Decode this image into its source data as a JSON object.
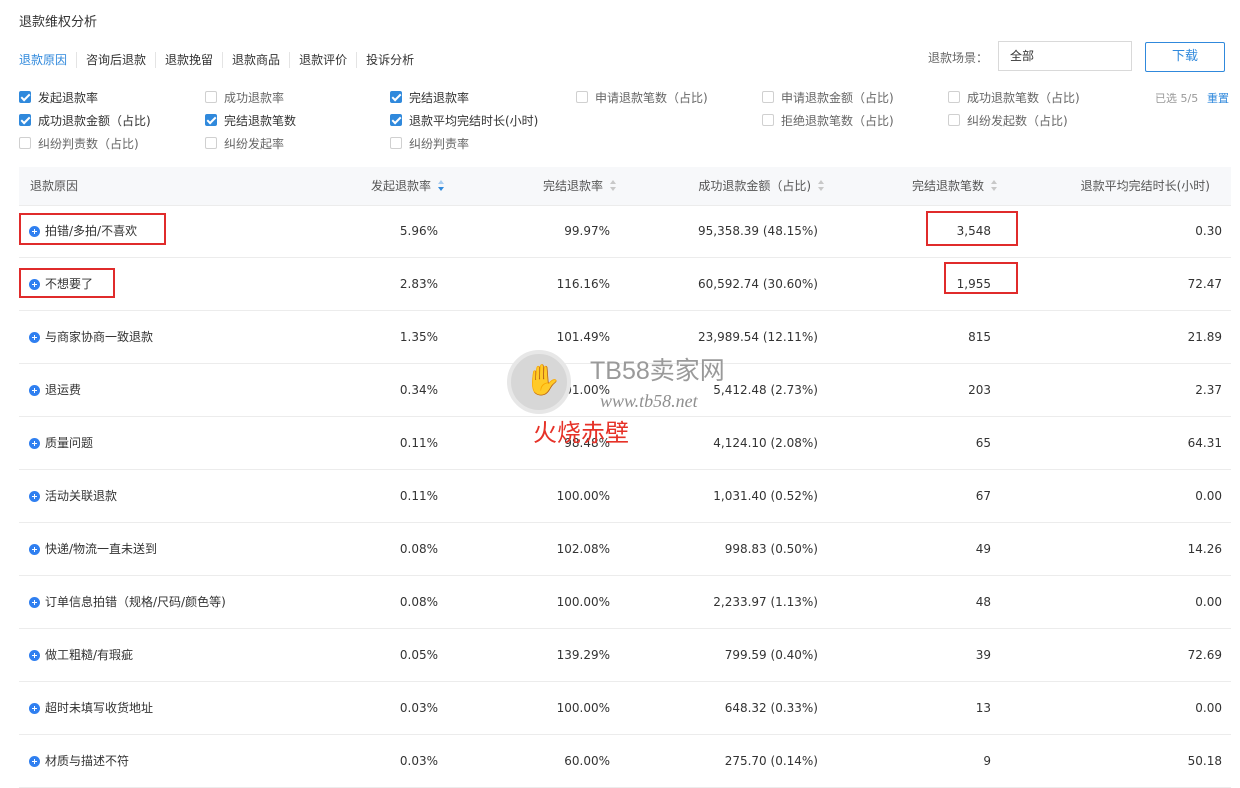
{
  "page": {
    "title": "退款维权分析"
  },
  "tabs": [
    {
      "label": "退款原因",
      "active": true
    },
    {
      "label": "咨询后退款",
      "active": false
    },
    {
      "label": "退款挽留",
      "active": false
    },
    {
      "label": "退款商品",
      "active": false
    },
    {
      "label": "退款评价",
      "active": false
    },
    {
      "label": "投诉分析",
      "active": false
    }
  ],
  "filter": {
    "scene_label": "退款场景：",
    "scene_value": "全部",
    "download_label": "下载"
  },
  "metrics": [
    {
      "label": "发起退款率",
      "checked": true
    },
    {
      "label": "成功退款率",
      "checked": false
    },
    {
      "label": "完结退款率",
      "checked": true
    },
    {
      "label": "申请退款笔数（占比)",
      "checked": false
    },
    {
      "label": "申请退款金额（占比)",
      "checked": false
    },
    {
      "label": "成功退款笔数（占比)",
      "checked": false
    },
    {
      "label": "成功退款金额（占比)",
      "checked": true
    },
    {
      "label": "完结退款笔数",
      "checked": true
    },
    {
      "label": "退款平均完结时长(小时)",
      "checked": true
    },
    {
      "label": "拒绝退款笔数（占比)",
      "checked": false
    },
    {
      "label": "纠纷发起数（占比)",
      "checked": false
    },
    {
      "label": "纠纷判责数（占比)",
      "checked": false
    },
    {
      "label": "纠纷发起率",
      "checked": false
    },
    {
      "label": "纠纷判责率",
      "checked": false
    }
  ],
  "selection": {
    "count": "已选 5/5",
    "reset": "重置"
  },
  "table": {
    "headers": [
      "退款原因",
      "发起退款率",
      "完结退款率",
      "成功退款金额（占比)",
      "完结退款笔数",
      "退款平均完结时长(小时)"
    ],
    "rows": [
      [
        "拍错/多拍/不喜欢",
        "5.96%",
        "99.97%",
        "95,358.39 (48.15%)",
        "3,548",
        "0.30"
      ],
      [
        "不想要了",
        "2.83%",
        "116.16%",
        "60,592.74 (30.60%)",
        "1,955",
        "72.47"
      ],
      [
        "与商家协商一致退款",
        "1.35%",
        "101.49%",
        "23,989.54 (12.11%)",
        "815",
        "21.89"
      ],
      [
        "退运费",
        "0.34%",
        "101.00%",
        "5,412.48 (2.73%)",
        "203",
        "2.37"
      ],
      [
        "质量问题",
        "0.11%",
        "98.48%",
        "4,124.10 (2.08%)",
        "65",
        "64.31"
      ],
      [
        "活动关联退款",
        "0.11%",
        "100.00%",
        "1,031.40 (0.52%)",
        "67",
        "0.00"
      ],
      [
        "快递/物流一直未送到",
        "0.08%",
        "102.08%",
        "998.83 (0.50%)",
        "49",
        "14.26"
      ],
      [
        "订单信息拍错（规格/尺码/颜色等)",
        "0.08%",
        "100.00%",
        "2,233.97 (1.13%)",
        "48",
        "0.00"
      ],
      [
        "做工粗糙/有瑕疵",
        "0.05%",
        "139.29%",
        "799.59 (0.40%)",
        "39",
        "72.69"
      ],
      [
        "超时未填写收货地址",
        "0.03%",
        "100.00%",
        "648.32 (0.33%)",
        "13",
        "0.00"
      ],
      [
        "材质与描述不符",
        "0.03%",
        "60.00%",
        "275.70 (0.14%)",
        "9",
        "50.18"
      ]
    ]
  },
  "watermark": {
    "brand": "TB58卖家网",
    "url": "www.tb58.net",
    "caption": "火烧赤壁"
  }
}
